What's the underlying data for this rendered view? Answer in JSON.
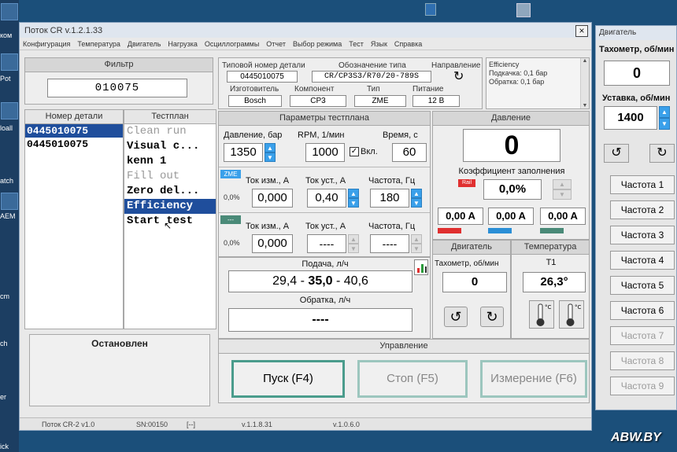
{
  "window": {
    "title": "Поток CR v.1.2.1.33",
    "close_label": "×",
    "menu": [
      "Конфигурация",
      "Температура",
      "Двигатель",
      "Нагрузка",
      "Осциллограммы",
      "Отчет",
      "Выбор режима",
      "Тест",
      "Язык",
      "Справка"
    ]
  },
  "filter": {
    "title": "Фильтр",
    "value": "010075"
  },
  "part_info": {
    "type_number_label": "Типовой номер детали",
    "type_number": "0445010075",
    "type_designation_label": "Обозначение типа",
    "type_designation": "CR/CP3S3/R70/20-789S",
    "direction_label": "Направление",
    "manufacturer_label": "Изготовитель",
    "manufacturer": "Bosch",
    "component_label": "Компонент",
    "component": "CP3",
    "kind_label": "Тип",
    "kind": "ZME",
    "power_label": "Питание",
    "power": "12 В"
  },
  "info_box": {
    "lines": [
      "Efficiency",
      "Подкачка: 0,1 бар",
      "Обратка: 0,1 бар"
    ]
  },
  "part_list": {
    "title": "Номер детали",
    "items": [
      "0445010075",
      "0445010075"
    ],
    "selected_index": 0
  },
  "test_plan": {
    "title": "Тестплан",
    "items": [
      {
        "label": "Clean run",
        "enabled": false
      },
      {
        "label": "Visual c...",
        "enabled": true
      },
      {
        "label": "kenn 1",
        "enabled": true
      },
      {
        "label": "Fill out",
        "enabled": false
      },
      {
        "label": "Zero del...",
        "enabled": true
      },
      {
        "label": "Efficiency",
        "enabled": true,
        "selected": true
      },
      {
        "label": "Start test",
        "enabled": true
      }
    ]
  },
  "status": {
    "text": "Остановлен"
  },
  "params": {
    "title": "Параметры тестплана",
    "pressure_label": "Давление, бар",
    "pressure": "1350",
    "rpm_label": "RPM, 1/мин",
    "rpm": "1000",
    "enable_label": "Вкл.",
    "time_label": "Время, с",
    "time": "60",
    "zme_tag": "ZME",
    "zme_pct": "0,0%",
    "meas_current_label": "Ток изм., А",
    "meas_current": "0,000",
    "set_current_label": "Ток уст., А",
    "set_current": "0,40",
    "freq_label": "Частота, Гц",
    "freq": "180",
    "row2_tag": "---",
    "row2_pct": "0,0%",
    "meas_current2_label": "Ток изм., А",
    "meas_current2": "0,000",
    "set_current2_label": "Ток уст., А",
    "set_current2": "----",
    "freq2_label": "Частота, Гц",
    "freq2": "----"
  },
  "flow": {
    "feed_label": "Подача, л/ч",
    "feed_min": "29,4",
    "feed_value": "35,0",
    "feed_max": "40,6",
    "return_label": "Обратка, л/ч",
    "return_value": "----"
  },
  "pressure": {
    "title": "Давление",
    "value": "0",
    "duty_label": "Коэффициент заполнения",
    "rail_tag": "Rail",
    "duty_value": "0,0%",
    "currents": [
      "0,00 A",
      "0,00 A",
      "0,00 A"
    ]
  },
  "engine": {
    "title": "Двигатель",
    "tacho_label": "Тахометр, об/мин",
    "tacho": "0"
  },
  "temperature": {
    "title": "Температура",
    "sensor_label": "T1",
    "value": "26,3°"
  },
  "control": {
    "title": "Управление",
    "start_label": "Пуск (F4)",
    "stop_label": "Стоп (F5)",
    "measure_label": "Измерение (F6)"
  },
  "statusbar": [
    "Поток CR-2 v1.0",
    "SN:00150",
    "[--]",
    "v.1.1.8.31",
    "v.1.0.6.0"
  ],
  "engine_window": {
    "title": "Двигатель",
    "tacho_label": "Тахометр, об/мин",
    "tacho": "0",
    "setpoint_label": "Уставка, об/мин",
    "setpoint": "1400",
    "freq_buttons": [
      "Частота 1",
      "Частота 2",
      "Частота 3",
      "Частота 4",
      "Частота 5",
      "Частота 6",
      "Частота 7",
      "Частота 8",
      "Частота 9"
    ]
  },
  "watermark": "ABW.BY",
  "desktop_labels": [
    "ком",
    "Pot",
    "loall",
    "atch",
    "AEM",
    "cm",
    "ch",
    "er",
    "ick"
  ],
  "colors": {
    "accent": "#3aa0ea",
    "selection": "#1f4e9c",
    "rail_red": "#e03030",
    "bar_blue": "#2b8fd6",
    "bar_teal": "#4a8a78",
    "button_border": "#4a9c8c"
  }
}
